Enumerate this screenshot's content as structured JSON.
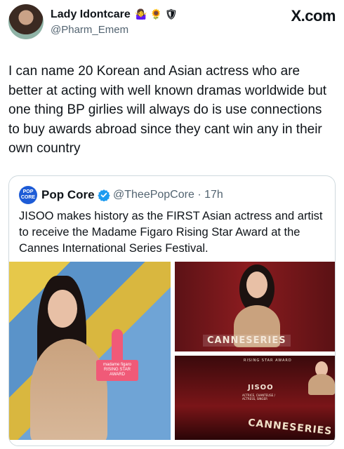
{
  "brand": {
    "watermark": "X.com"
  },
  "author": {
    "name": "Lady Idontcare",
    "emojis": "🤷‍♀️ 🌻 🛡",
    "handle": "@Pharm_Emem"
  },
  "tweet": {
    "text": "I can name 20 Korean and Asian actress who are better at acting with well known dramas worldwide but one thing BP girlies will always do is use connections to buy awards abroad since they cant win any in their own country"
  },
  "quoted": {
    "avatar_text": "POP CORE",
    "name": "Pop Core",
    "handle": "@TheePopCore",
    "time": "· 17h",
    "text": "JISOO makes history as the FIRST Asian actress and artist to receive the Madame Figaro Rising Star Award at the Cannes International Series Festival.",
    "verified_color": "#1d9bf0",
    "images": {
      "left_trophy_text": "madame figaro RISING STAR AWARD",
      "top_right_sign": "CANNESERIES",
      "bottom_right_award": "RISING STAR AWARD",
      "bottom_right_name": "JISOO",
      "bottom_right_role": "ACTRICE, CHANTEUSE / ACTRESS, SINGER",
      "bottom_right_sign": "CANNESERIES"
    }
  }
}
